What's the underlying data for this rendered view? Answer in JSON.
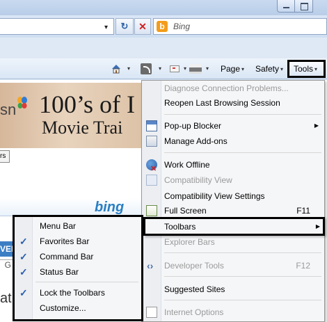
{
  "browser": {
    "search": {
      "placeholder": "Bing",
      "logo_letter": "b"
    },
    "address": {
      "dropdown_glyph": "▾"
    },
    "buttons": {
      "refresh_glyph": "↻",
      "stop_glyph": "✕"
    }
  },
  "command_bar": {
    "page_label": "Page",
    "safety_label": "Safety",
    "tools_label": "Tools",
    "caret": "▾"
  },
  "content": {
    "msn_fragment": "sn",
    "ad_headline_1": "100’s of I",
    "ad_headline_2": "Movie Trai",
    "button_fragment": "rs",
    "bing_logo": "bing",
    "blue_fragment": "VER",
    "g_fragment": "G",
    "at_fragment": "at"
  },
  "tools_menu": {
    "items": [
      {
        "label": "Diagnose Connection Problems...",
        "disabled": true
      },
      {
        "label": "Reopen Last Browsing Session",
        "disabled": false
      },
      {
        "label": "Pop-up Blocker",
        "disabled": false,
        "submenu": true
      },
      {
        "label": "Manage Add-ons",
        "disabled": false
      },
      {
        "label": "Work Offline",
        "disabled": false
      },
      {
        "label": "Compatibility View",
        "disabled": true
      },
      {
        "label": "Compatibility View Settings",
        "disabled": false
      },
      {
        "label": "Full Screen",
        "shortcut": "F11",
        "disabled": false
      },
      {
        "label": "Toolbars",
        "disabled": false,
        "submenu": true
      },
      {
        "label": "Explorer Bars",
        "disabled": true
      },
      {
        "label": "Developer Tools",
        "shortcut": "F12",
        "disabled": true
      },
      {
        "label": "Suggested Sites",
        "disabled": false
      },
      {
        "label": "Internet Options",
        "disabled": true
      }
    ],
    "submenu_arrow": "▶"
  },
  "toolbars_submenu": {
    "check_glyph": "✓",
    "items": [
      {
        "label": "Menu Bar",
        "checked": false
      },
      {
        "label": "Favorites Bar",
        "checked": true
      },
      {
        "label": "Command Bar",
        "checked": true
      },
      {
        "label": "Status Bar",
        "checked": true
      },
      {
        "label": "Lock the Toolbars",
        "checked": true
      },
      {
        "label": "Customize...",
        "checked": false
      }
    ]
  }
}
